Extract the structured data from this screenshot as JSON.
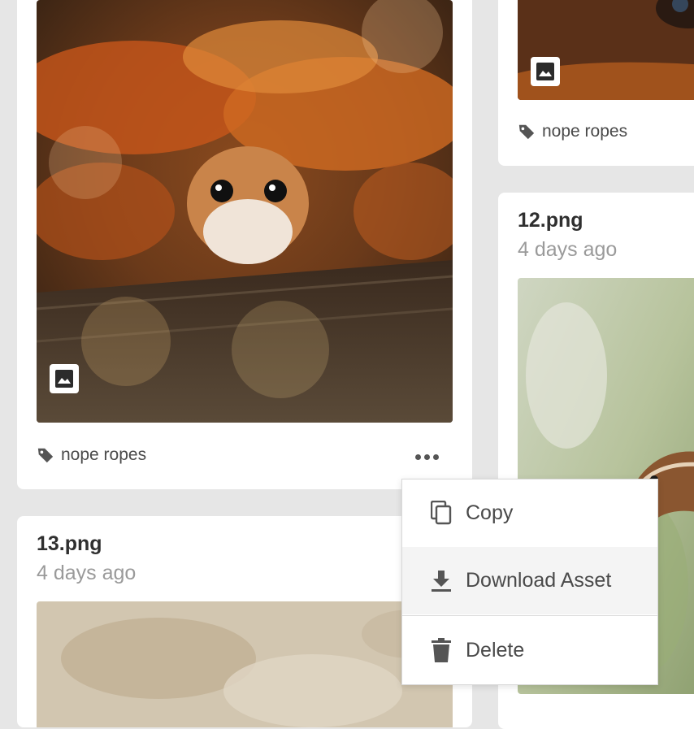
{
  "cards": [
    {
      "tag": "nope ropes"
    },
    {
      "tag": "nope ropes"
    },
    {
      "title": "12.png",
      "date": "4 days ago"
    },
    {
      "title": "13.png",
      "date": "4 days ago"
    }
  ],
  "context_menu": {
    "items": [
      {
        "label": "Copy",
        "icon": "copy-icon"
      },
      {
        "label": "Download Asset",
        "icon": "download-icon"
      },
      {
        "label": "Delete",
        "icon": "trash-icon"
      }
    ]
  },
  "colors": {
    "card_bg": "#ffffff",
    "page_bg": "#e6e6e6",
    "menu_hover": "#f4f4f4"
  }
}
